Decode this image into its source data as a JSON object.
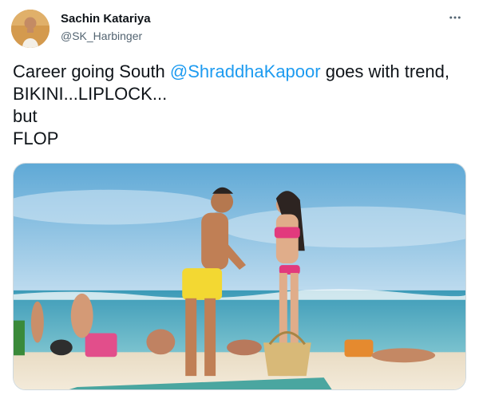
{
  "author": {
    "display_name": "Sachin Katariya",
    "handle": "@SK_Harbinger",
    "avatar_icon": "avatar-image"
  },
  "tweet": {
    "text_before": "Career going South ",
    "mention": "@ShraddhaKapoor",
    "text_after": " goes with trend, BIKINI...LIPLOCK...\nbut\nFLOP"
  },
  "media": {
    "icon": "beach-photo"
  },
  "menu": {
    "icon": "more-icon"
  },
  "colors": {
    "link": "#1d9bf0",
    "text": "#0f1419",
    "secondary": "#536471"
  }
}
